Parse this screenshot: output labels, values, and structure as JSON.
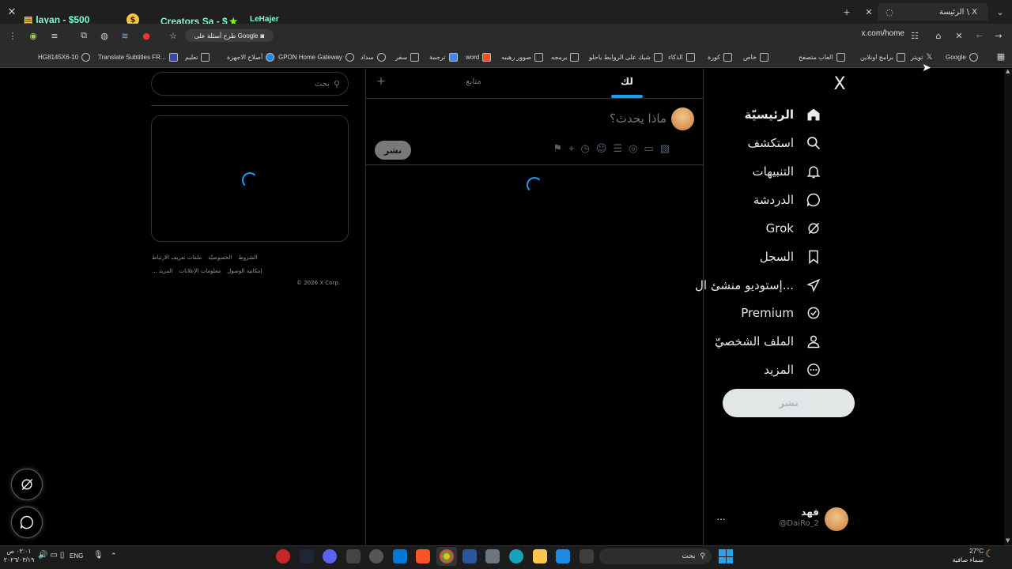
{
  "browser": {
    "tab_title": "الرئيسة \\ X",
    "url": "x.com/home",
    "google_ask": "طرح أسئلة على Google",
    "bookmarks": [
      "Google",
      "تويتر",
      "برامج اونلاين",
      "العاب متصفح",
      "خاص",
      "كورة",
      "الذكاء",
      "شيك على الروابط ياحلو",
      "برمجه",
      "صوور رهيبه",
      "word",
      "ترجمة",
      "سفر",
      "سداد",
      "GPON Home Gateway",
      "أصلاح الاجهزة",
      "تعليم",
      "Translate Subtitles FR...",
      "HG8145X6-10"
    ]
  },
  "overlay": {
    "ticker1": "layan - $500",
    "ticker2": "Creators Sa - $",
    "ticker3": "LeHajer"
  },
  "x": {
    "logo": "X",
    "nav": [
      {
        "label": "الرئيسيّة",
        "icon": "home-icon",
        "active": true
      },
      {
        "label": "استكشف",
        "icon": "search-icon"
      },
      {
        "label": "التنبيهات",
        "icon": "bell-icon"
      },
      {
        "label": "الدردشة",
        "icon": "chat-icon"
      },
      {
        "label": "Grok",
        "icon": "grok-icon"
      },
      {
        "label": "السجل",
        "icon": "bookmark-icon"
      },
      {
        "label": "إستوديو منشئ ال...",
        "icon": "rocket-icon"
      },
      {
        "label": "Premium",
        "icon": "verified-icon"
      },
      {
        "label": "الملف الشخصيّ",
        "icon": "person-icon"
      },
      {
        "label": "المزيد",
        "icon": "more-circle-icon"
      }
    ],
    "post_button": "نشر",
    "account": {
      "name": "فهد",
      "handle": "@DaiRo_2",
      "more": "..."
    },
    "tabs": {
      "for_you": "لك",
      "following": "متابع",
      "add": "+"
    },
    "composer": {
      "placeholder": "ماذا يحدث؟",
      "post": "نشر"
    },
    "search": {
      "placeholder": "بحث"
    },
    "footer": {
      "line1": [
        "الشروط",
        "الخصوصيّة",
        "ملفات تعريف الارتباط"
      ],
      "line2": [
        "إمكانية الوصول",
        "معلومات الإعلانات",
        "المزيد ..."
      ],
      "copyright": "© 2026 X Corp."
    }
  },
  "taskbar": {
    "weather_temp": "27°C",
    "weather_desc": "سماء صافية",
    "search_placeholder": "بحث",
    "lang": "ENG",
    "time": "٠٢:٠١ ص",
    "date": "٢٠٢٦/٠٣/١٩"
  },
  "colors": {
    "accent": "#1d9bf0",
    "background": "#000000",
    "border": "#2f3336",
    "text": "#e7e9ea",
    "muted": "#71767b"
  }
}
